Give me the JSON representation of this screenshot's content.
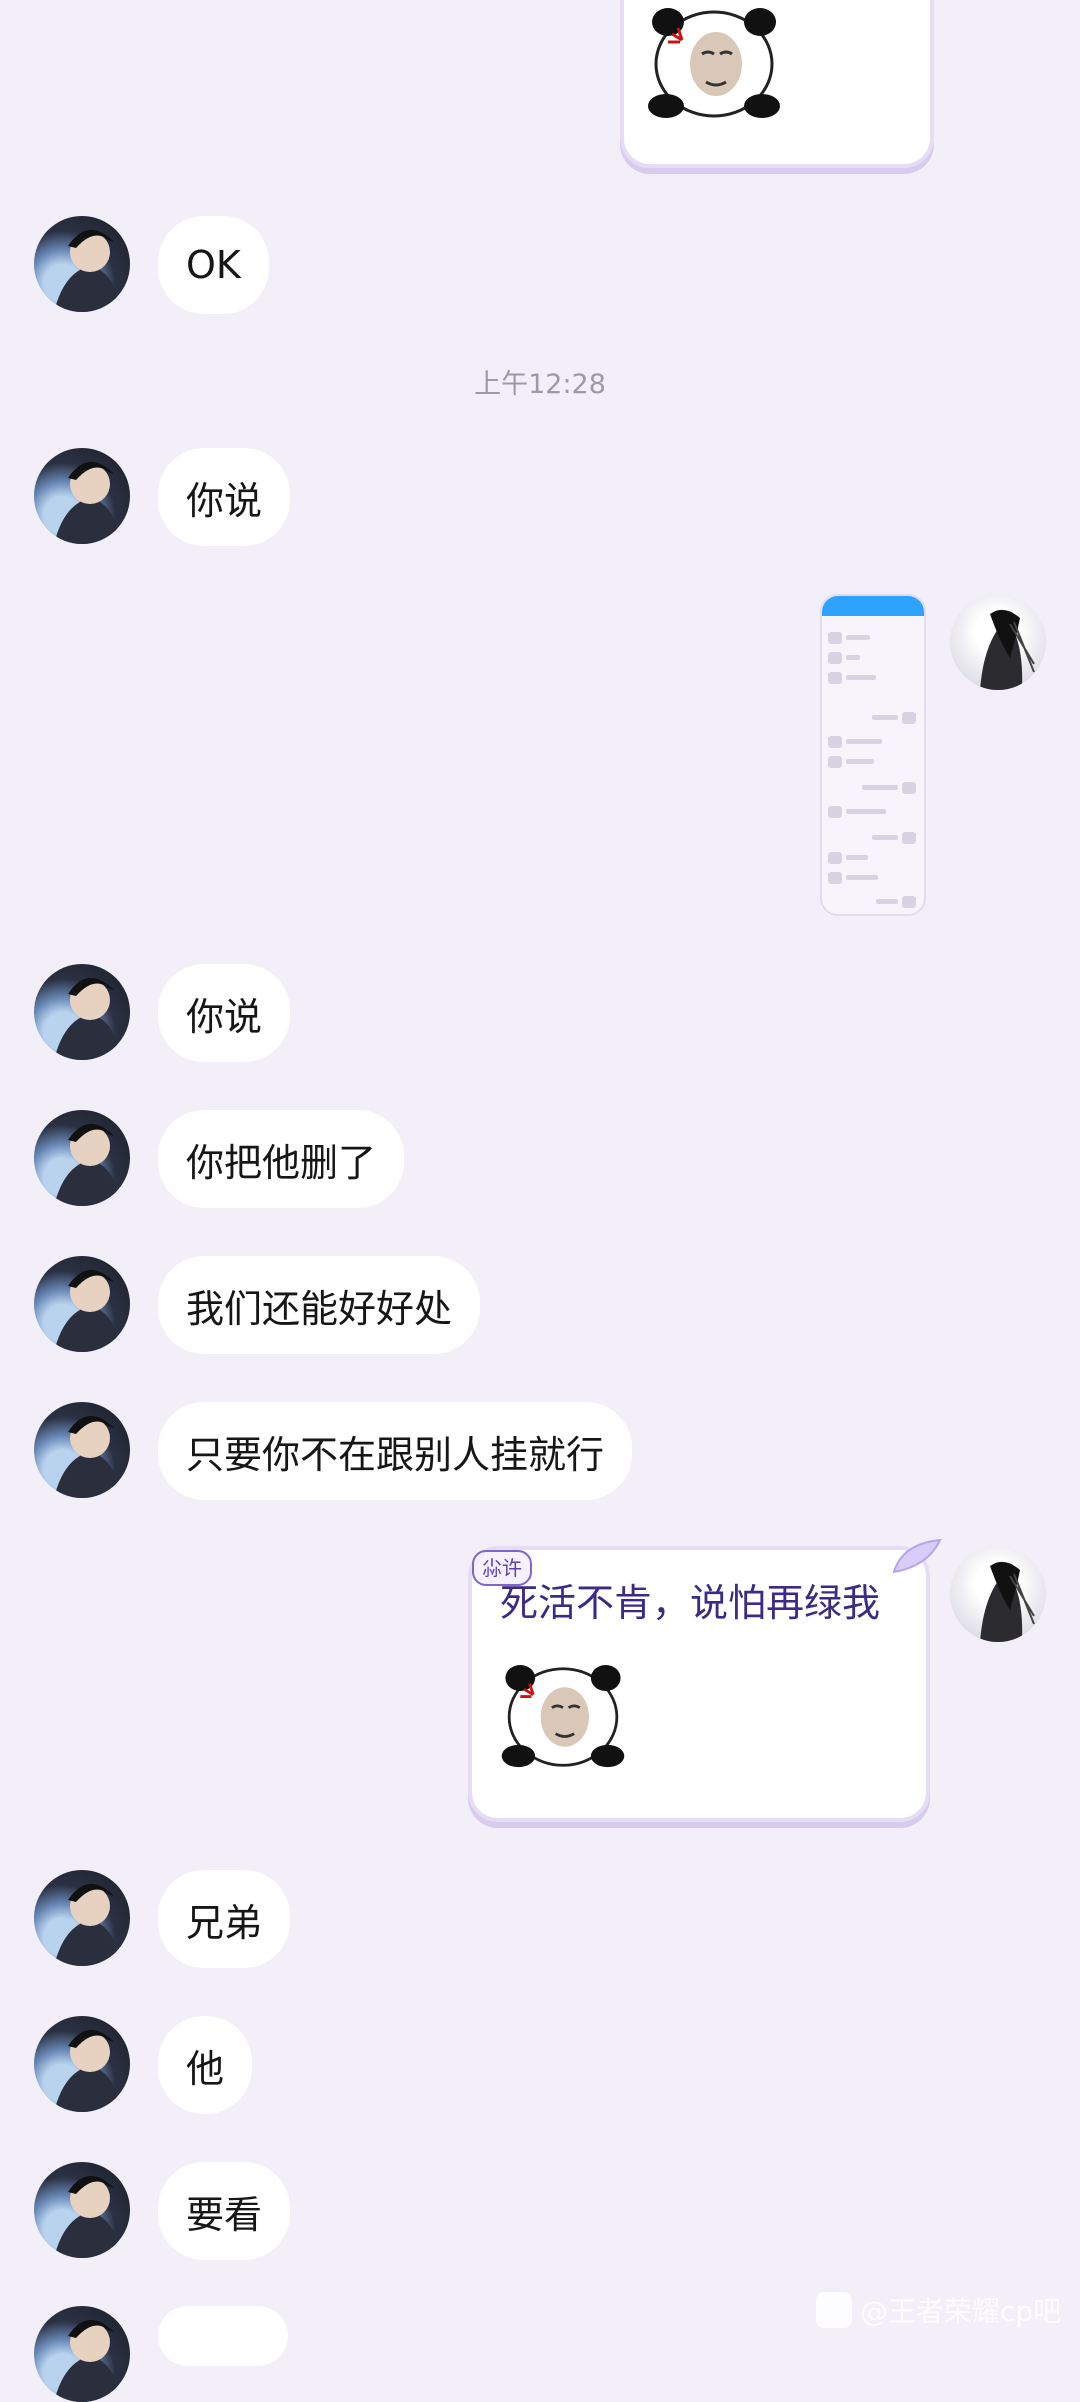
{
  "timestamp": "上午12:28",
  "messages": [
    {
      "side": "left",
      "text": "OK"
    },
    {
      "side": "left",
      "text": "你说"
    },
    {
      "side": "left",
      "text": "你说"
    },
    {
      "side": "left",
      "text": "你把他删了"
    },
    {
      "side": "left",
      "text": "我们还能好好处"
    },
    {
      "side": "left",
      "text": "只要你不在跟别人挂就行"
    },
    {
      "side": "left",
      "text": "兄弟"
    },
    {
      "side": "left",
      "text": "他"
    },
    {
      "side": "left",
      "text": "要看"
    }
  ],
  "sticker_message": {
    "badge": "尛许",
    "caption": "死活不肯，说怕再绿我"
  },
  "watermark": "@王者荣耀cp吧",
  "colors": {
    "background": "#f2eff8",
    "bubble": "#ffffff",
    "caption_text": "#3b2a86",
    "badge_border": "#7e66c9"
  }
}
